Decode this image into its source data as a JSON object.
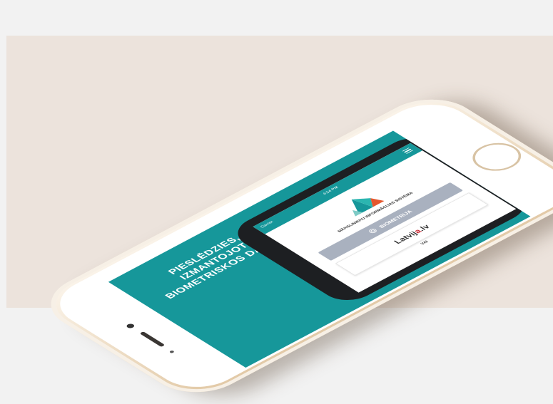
{
  "colors": {
    "teal": "#16979a",
    "button_grey": "#a9b1bf",
    "phone_gold": "#e2c9a6",
    "accent_red": "#c8242f",
    "background": "#ece3dc"
  },
  "screen": {
    "title": "PIESLĒDZIES, IZMANTOJOT BIOMETRISKOS DATUS"
  },
  "inner_app": {
    "status_left": "Carrier",
    "status_time": "4:54 PM",
    "menu_icon": "hamburger-icon",
    "system_name": "MĀKSLINIEKU INFORMĀCIJAS SISTĒMA",
    "biometrics_button": "BIOMETRIJA",
    "biometrics_icon": "fingerprint-icon",
    "latvija_prefix": "Latvij",
    "latvija_accent": "a",
    "latvija_suffix": ".lv",
    "or_text": "VAI"
  }
}
